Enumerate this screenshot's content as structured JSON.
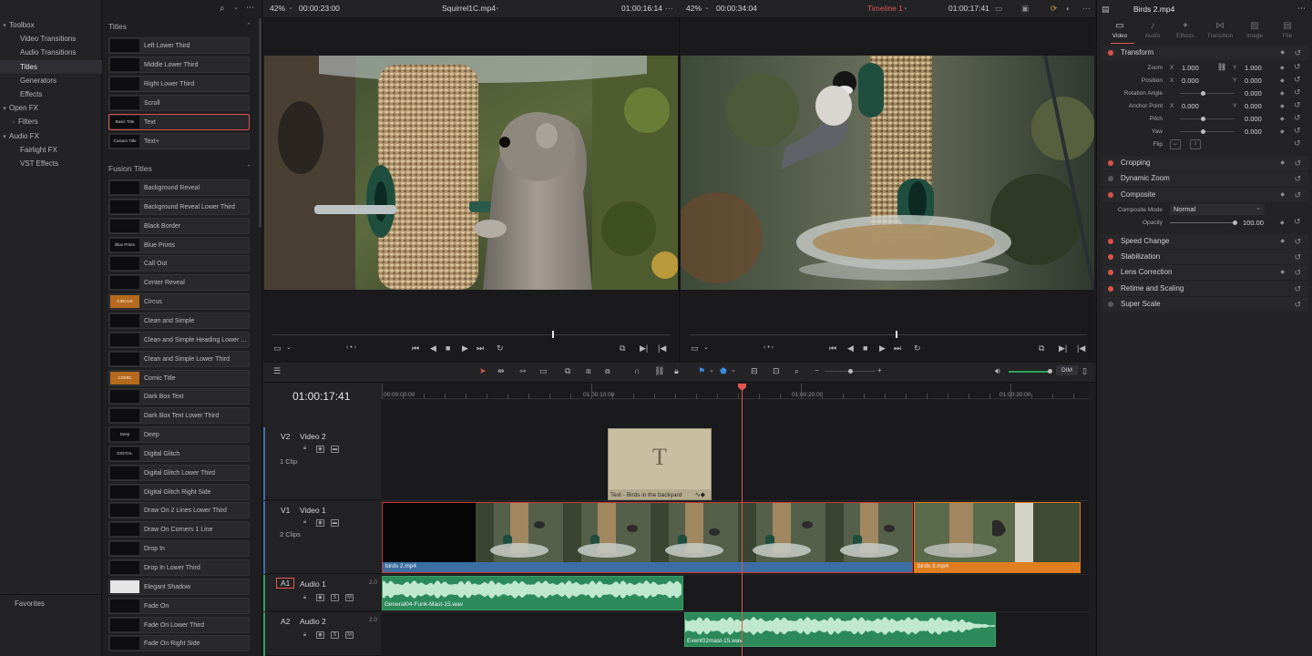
{
  "toolbox": {
    "items": [
      {
        "label": "Toolbox",
        "caret": "▾"
      },
      {
        "label": "Video Transitions"
      },
      {
        "label": "Audio Transitions"
      },
      {
        "label": "Titles"
      },
      {
        "label": "Generators"
      },
      {
        "label": "Effects"
      },
      {
        "label": "Open FX",
        "caret": "▾"
      },
      {
        "label": "Filters",
        "caret": "›"
      },
      {
        "label": "Audio FX",
        "caret": "▾"
      },
      {
        "label": "Fairlight FX"
      },
      {
        "label": "VST Effects"
      }
    ],
    "favorites": "Favorites"
  },
  "titles": {
    "section1": "Titles",
    "items1": [
      {
        "label": "Left Lower Third",
        "thumb": ""
      },
      {
        "label": "Middle Lower Third",
        "thumb": ""
      },
      {
        "label": "Right Lower Third",
        "thumb": ""
      },
      {
        "label": "Scroll",
        "thumb": ""
      },
      {
        "label": "Text",
        "thumb": "Basic Title"
      },
      {
        "label": "Text+",
        "thumb": "Custom Title"
      }
    ],
    "section2": "Fusion Titles",
    "items2": [
      "Background Reveal",
      "Background Reveal Lower Third",
      "Black Border",
      "Blue Prints",
      "Call Out",
      "Center Reveal",
      "Circus",
      "Clean and Simple",
      "Clean and Simple Heading Lower T...",
      "Clean and Simple Lower Third",
      "Comic Title",
      "Dark Box Text",
      "Dark Box Text Lower Third",
      "Deep",
      "Digital Glitch",
      "Digital Glitch Lower Third",
      "Digital Glitch Right Side",
      "Draw On 2 Lines Lower Third",
      "Draw On Corners 1 Line",
      "Drop In",
      "Drop In Lower Third",
      "Elegant Shadow",
      "Fade On",
      "Fade On Lower Third",
      "Fade On Right Side"
    ],
    "thumbs2": [
      "",
      "",
      "",
      "Blue Prints",
      "",
      "",
      "CIRCUS",
      "",
      "",
      "",
      "COMIC",
      "",
      "",
      "Deep",
      "DIGITAL GLITCH",
      "",
      "",
      "",
      "",
      "",
      "",
      "",
      "",
      "",
      ""
    ]
  },
  "source_viewer": {
    "zoom": "42%",
    "timecode_left": "00:00:23:00",
    "clip_name": "Squirrel1C.mp4",
    "timecode_right": "01:00:16:14"
  },
  "timeline_viewer": {
    "zoom": "42%",
    "timecode_left": "00:00:34:04",
    "timeline_name": "Timeline 1",
    "timecode_right": "01:00:17:41"
  },
  "inspector": {
    "clip_name": "Birds 2.mp4",
    "tabs": [
      "Video",
      "Audio",
      "Effects",
      "Transition",
      "Image",
      "File"
    ],
    "transform": {
      "title": "Transform",
      "zoom_label": "Zoom",
      "zoom_x": "1.000",
      "zoom_y": "1.000",
      "position_label": "Position",
      "position_x": "0.000",
      "position_y": "0.000",
      "rotation_label": "Rotation Angle",
      "rotation": "0.000",
      "anchor_label": "Anchor Point",
      "anchor_x": "0.000",
      "anchor_y": "0.000",
      "pitch_label": "Pitch",
      "pitch": "0.000",
      "yaw_label": "Yaw",
      "yaw": "0.000",
      "flip_label": "Flip"
    },
    "sections": [
      "Cropping",
      "Dynamic Zoom",
      "Composite",
      "Speed Change",
      "Stabilization",
      "Lens Correction",
      "Retime and Scaling",
      "Super Scale"
    ],
    "composite": {
      "mode_label": "Composite Mode",
      "mode": "Normal",
      "opacity_label": "Opacity",
      "opacity": "100.00"
    }
  },
  "timeline": {
    "timecode": "01:00:17:41",
    "ruler": [
      "00:00:00:00",
      "01:00:10:00",
      "01:00:20:00",
      "01:00:30:00"
    ],
    "dim_label": "DIM",
    "tracks": {
      "v2": {
        "id": "V2",
        "name": "Video 2",
        "clips": "1 Clip"
      },
      "v1": {
        "id": "V1",
        "name": "Video 1",
        "clips": "2 Clips"
      },
      "a1": {
        "id": "A1",
        "name": "Audio 1",
        "level": "2.0"
      },
      "a2": {
        "id": "A2",
        "name": "Audio 2",
        "level": "2.0"
      }
    },
    "clips": {
      "text_clip": "Text - Birds in the backyard",
      "text_glyph": "T",
      "birds2": "birds 2.mp4",
      "birds3": "birds 3.mp4",
      "audio1": "General04-Funk-Mast-15.wav",
      "audio2": "Event02mast-15.wav"
    },
    "solo": "S",
    "mute": "M"
  }
}
